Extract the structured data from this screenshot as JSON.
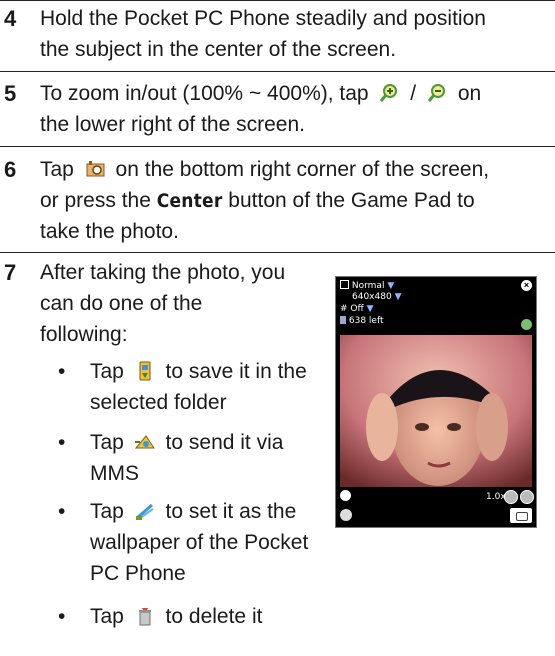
{
  "steps": [
    {
      "number": "4",
      "line1": "Hold the Pocket PC Phone steadily and position",
      "line2": "the subject in the center of the screen."
    },
    {
      "number": "5",
      "line1_a": "To zoom in/out (100% ~ 400%), tap",
      "line1_sep": "/",
      "line1_b": "on",
      "line2": "the lower right of the screen.",
      "icons": [
        "zoom-in-icon",
        "zoom-out-icon"
      ]
    },
    {
      "number": "6",
      "line1_a": "Tap",
      "line1_b": "on the bottom right corner of the screen,",
      "line2_a": "or press the",
      "line2_center": "Center",
      "line2_b": "button of the Game Pad to",
      "line3": "take the photo.",
      "icons": [
        "camera-icon"
      ]
    },
    {
      "number": "7",
      "line1": "After taking the photo, you",
      "line2": "can do one of the",
      "line3": "following:"
    }
  ],
  "bullets": [
    {
      "line1_a": "Tap",
      "line1_b": "to save it in the",
      "line2": "selected folder",
      "icon": "save-to-folder-icon"
    },
    {
      "line1_a": "Tap",
      "line1_b": "to send it via",
      "line2": "MMS",
      "icon": "send-mms-icon"
    },
    {
      "line1_a": "Tap",
      "line1_b": "to set it as the",
      "line2": "wallpaper of the Pocket",
      "line3": "PC Phone",
      "icon": "set-wallpaper-icon"
    },
    {
      "line1_a": "Tap",
      "line1_b": "to delete it",
      "icon": "trash-icon"
    }
  ],
  "phone_screen": {
    "mode": "Normal",
    "resolution": "640x480",
    "flash": "Off",
    "remaining": "638 left",
    "zoom": "1.0x"
  },
  "colors": {
    "rule": "#222222",
    "text": "#1a1a1a"
  }
}
